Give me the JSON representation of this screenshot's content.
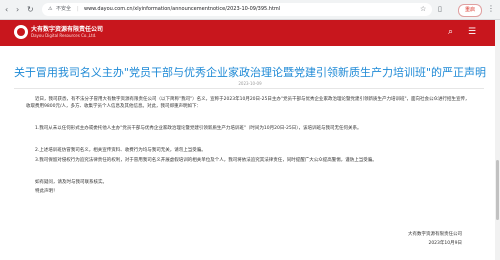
{
  "browser": {
    "back_icon": "‹",
    "forward_icon": "›",
    "reload_icon": "↻",
    "security_warning_icon": "⚠",
    "security_label": "不安全",
    "url": "www.dayou.com.cn/xlyinformation/announcementnotice/2023-10-09/395.html",
    "star_icon": "☆",
    "profile_label": "重启",
    "menu_icon": "⋮"
  },
  "site": {
    "brand_cn": "大有数字资源有限责任公司",
    "brand_en": "Dayou Digital Resources Co.,Ltd.",
    "accent": "#c8161d"
  },
  "article": {
    "title": "关于冒用我司名义主办\"党员干部与优秀企业家政治理论暨党建引领新质生产力培训班\"的严正声明",
    "date": "2023-10-09",
    "paragraphs": [
      "近日，我司获悉，有不法分子冒用大有数字资源有限责任公司（以下简称\"我司\"）名义，宣称于2023年10月20日-25日主办\"党员干部与优秀企业家政治理论暨党建引领新质生产力培训班\"，面向社会公众进行招生宣传，收取费用9800元/人，多方、收集学员个人信息及其他信息。对此，我司郑重声明如下：",
      "1.我司从未以任何形式主办或委托他人主办\"党员干部与优秀企业家政治理论暨党建引领新质生产力培训班\"（时间为10月20日-25日），该培训班与我司无任何关系。",
      "2.上述培训班仿冒我司名义，相关宣传资料、收费行为均与我司无关，请勿上当受骗。",
      "3.我司保留对侵权行为追究法律责任的权利，对于冒用我司名义开展虚假培训的相关单位及个人，我司将依法追究其法律责任，同时提醒广大公众提高警惕，谨防上当受骗。",
      "如有疑问，请及时与我司联系核实。",
      "特此声明！"
    ],
    "signature_company": "大有数字资源有限责任公司",
    "signature_date": "2023年10月9日"
  }
}
